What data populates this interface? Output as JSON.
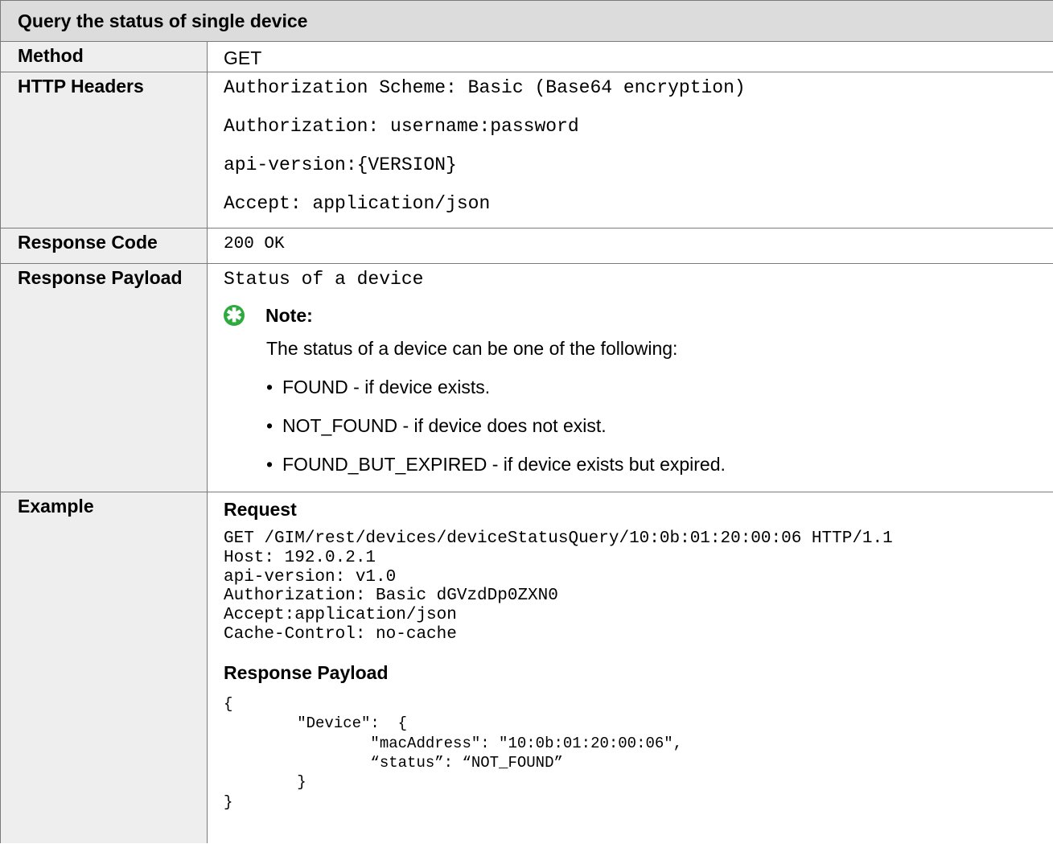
{
  "title": "Query the status of single device",
  "rows": {
    "method": {
      "label": "Method",
      "value": "GET"
    },
    "headers": {
      "label": "HTTP Headers",
      "lines": [
        "Authorization Scheme: Basic (Base64 encryption)",
        "Authorization: username:password",
        "api-version:{VERSION}",
        "Accept: application/json"
      ]
    },
    "response_code": {
      "label": "Response Code",
      "value": "200 OK"
    },
    "response_payload": {
      "label": "Response Payload",
      "value": "Status of a device",
      "note": {
        "icon": "star-asterisk-icon",
        "icon_glyph": "✱",
        "icon_color": "#2eaa3f",
        "label": "Note:",
        "intro": "The status of a device can be one of the following:",
        "bullets": [
          "FOUND - if device exists.",
          "NOT_FOUND - if device does not exist.",
          "FOUND_BUT_EXPIRED - if device exists but expired."
        ]
      }
    },
    "example": {
      "label": "Example",
      "request_heading": "Request",
      "request_code": "GET /GIM/rest/devices/deviceStatusQuery/10:0b:01:20:00:06 HTTP/1.1\nHost: 192.0.2.1\napi-version: v1.0\nAuthorization: Basic dGVzdDp0ZXN0\nAccept:application/json\nCache-Control: no-cache",
      "response_heading": "Response Payload",
      "response_code": "{\n        \"Device\":  {\n                \"macAddress\": \"10:0b:01:20:00:06\",\n                “status”: “NOT_FOUND”\n        }\n}"
    }
  }
}
